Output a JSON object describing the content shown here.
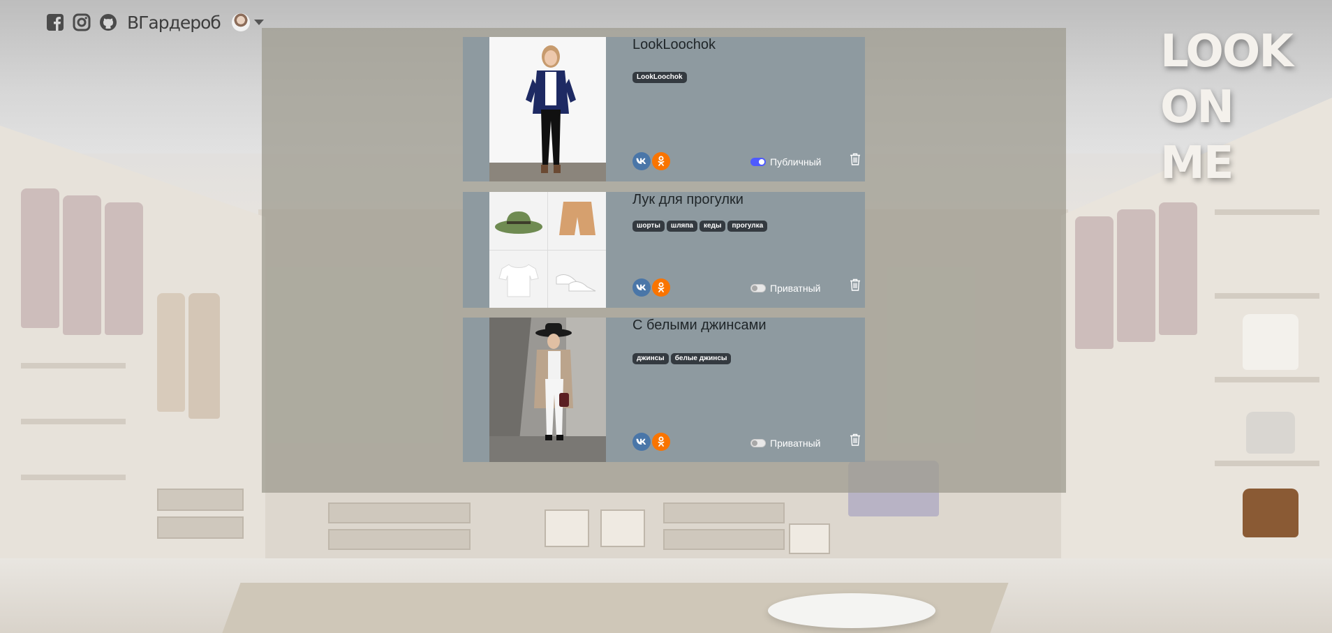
{
  "header": {
    "brand": "ВГардероб",
    "icons": [
      "facebook-icon",
      "instagram-icon",
      "github-icon"
    ]
  },
  "logo": {
    "lines": [
      "LOOK",
      "ON",
      "ME"
    ]
  },
  "colors": {
    "card_bg": "#8e9aa0",
    "tag_bg": "#343a40",
    "vk": "#4a76a8",
    "ok": "#f97400",
    "switch_on": "#4f5bff"
  },
  "looks": [
    {
      "title": "LookLoochok",
      "tags": [
        "LookLoochok"
      ],
      "privacy_label": "Публичный",
      "is_public": true,
      "thumbnail": "full-body photo: woman in navy blazer, white top, black jeans"
    },
    {
      "title": "Лук для прогулки",
      "tags": [
        "шорты",
        "шляпа",
        "кеды",
        "прогулка"
      ],
      "privacy_label": "Приватный",
      "is_public": false,
      "thumbnail": "4 items: green hat, tan shorts, white t-shirt, white sneakers"
    },
    {
      "title": "С белыми джинсами",
      "tags": [
        "джинсы",
        "белые джинсы"
      ],
      "privacy_label": "Приватный",
      "is_public": false,
      "thumbnail": "street photo: woman in black hat, beige coat, white jeans"
    }
  ],
  "share": {
    "vk_label": "VK",
    "ok_label": "OK"
  }
}
